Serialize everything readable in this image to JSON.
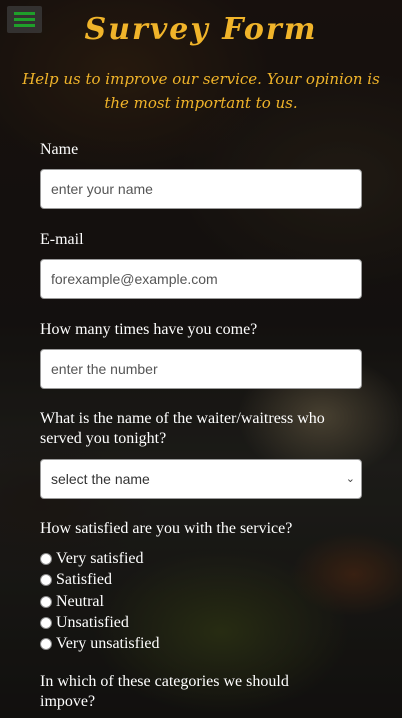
{
  "header": {
    "title": "Survey Form",
    "subtitle": "Help us to improve our service. Your opinion is the most important to us."
  },
  "menu": {
    "icon": "hamburger-menu-icon"
  },
  "form": {
    "name_label": "Name",
    "name_placeholder": "enter your name",
    "email_label": "E-mail",
    "email_placeholder": "forexample@example.com",
    "visits_label": "How many times have you come?",
    "visits_placeholder": "enter the number",
    "waiter_label": "What is the name of the waiter/waitress who served you tonight?",
    "waiter_selected": "select the name",
    "satisfaction_label": "How satisfied are you with the service?",
    "satisfaction_options": [
      "Very satisfied",
      "Satisfied",
      "Neutral",
      "Unsatisfied",
      "Very unsatisfied"
    ],
    "improve_label": "In which of these categories we should impove?"
  },
  "colors": {
    "accent": "#f0b42a",
    "menu_icon": "#1f9e2a"
  }
}
